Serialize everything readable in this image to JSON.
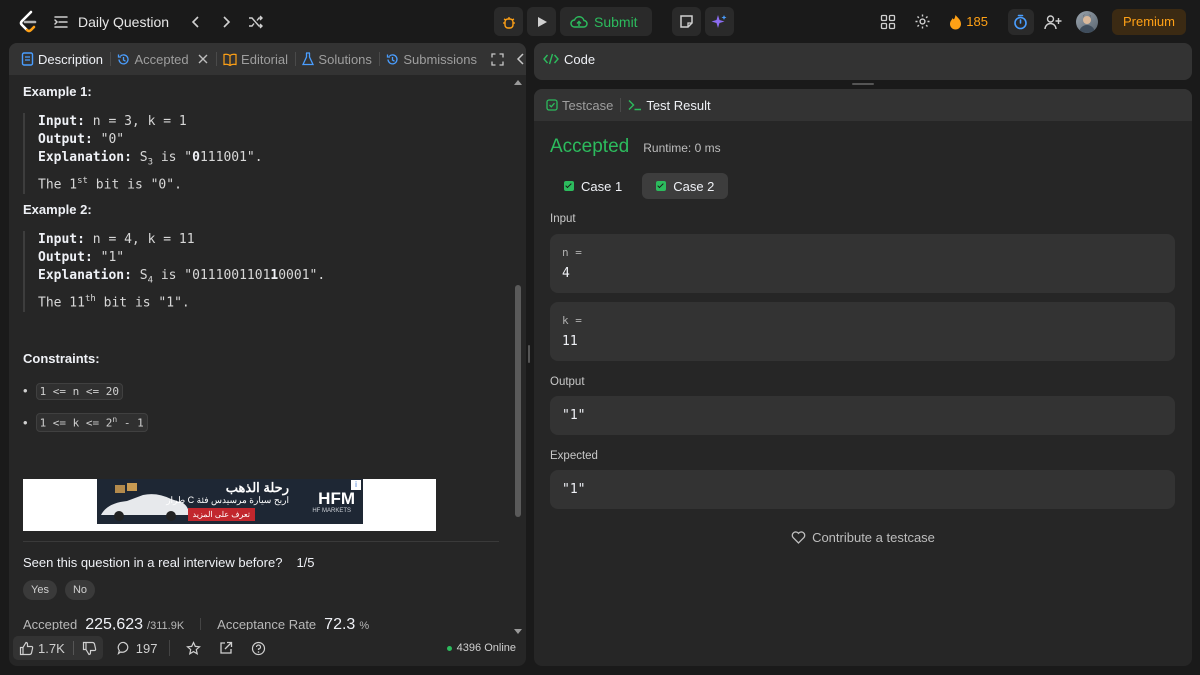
{
  "topbar": {
    "title": "Daily Question",
    "submit_label": "Submit",
    "streak": "185",
    "premium_label": "Premium"
  },
  "left_tabs": {
    "description": "Description",
    "accepted": "Accepted",
    "editorial": "Editorial",
    "solutions": "Solutions",
    "submissions": "Submissions"
  },
  "content": {
    "example1": {
      "heading": "Example 1:",
      "input_label": "Input:",
      "input_value": " n = 3, k = 1",
      "output_label": "Output:",
      "output_value": " \"0\"",
      "explanation_label": "Explanation:",
      "expl_pre": " S",
      "expl_sub": "3",
      "expl_mid": " is \"",
      "expl_bold": "0",
      "expl_post": "111001\".",
      "line2_pre": "The 1",
      "line2_sup": "st",
      "line2_post": " bit is \"0\"."
    },
    "example2": {
      "heading": "Example 2:",
      "input_label": "Input:",
      "input_value": " n = 4, k = 11",
      "output_label": "Output:",
      "output_value": " \"1\"",
      "explanation_label": "Explanation:",
      "expl_pre": " S",
      "expl_sub": "4",
      "expl_mid": " is \"0111001101",
      "expl_bold": "1",
      "expl_post": "0001\".",
      "line2_pre": "The 11",
      "line2_sup": "th",
      "line2_post": " bit is \"1\"."
    },
    "constraints_heading": "Constraints:",
    "constraint1": "1 <= n <= 20",
    "constraint2_pre": "1 <= k <= 2",
    "constraint2_sup": "n",
    "constraint2_post": " - 1",
    "ad": {
      "title": "رحلة الذهب",
      "subtitle": "اربح سيارة مرسيدس فئة C طراز",
      "cta": "تعرف على المزيد",
      "brand": "HFM",
      "brand_sub": "HF MARKETS"
    },
    "interview_q": "Seen this question in a real interview before?",
    "interview_count": "1/5",
    "yes": "Yes",
    "no": "No",
    "accepted_label": "Accepted",
    "accepted_value": "225,623",
    "accepted_total": "/311.9K",
    "rate_label": "Acceptance Rate",
    "rate_value": "72.3",
    "rate_unit": "%"
  },
  "bottombar": {
    "likes": "1.7K",
    "comments": "197",
    "online": "4396 Online"
  },
  "code_panel": {
    "title": "Code"
  },
  "result_panel": {
    "tab_testcase": "Testcase",
    "tab_result": "Test Result",
    "status": "Accepted",
    "runtime": "Runtime: 0 ms",
    "case1": "Case 1",
    "case2": "Case 2",
    "input_label": "Input",
    "n_label": "n =",
    "n_value": "4",
    "k_label": "k =",
    "k_value": "11",
    "output_label": "Output",
    "output_value": "\"1\"",
    "expected_label": "Expected",
    "expected_value": "\"1\"",
    "contribute": "Contribute a testcase"
  },
  "colors": {
    "accent_green": "#2cbb5d",
    "orange": "#ffa116",
    "blue": "#4a9eff",
    "purple": "#8b6cf0"
  }
}
